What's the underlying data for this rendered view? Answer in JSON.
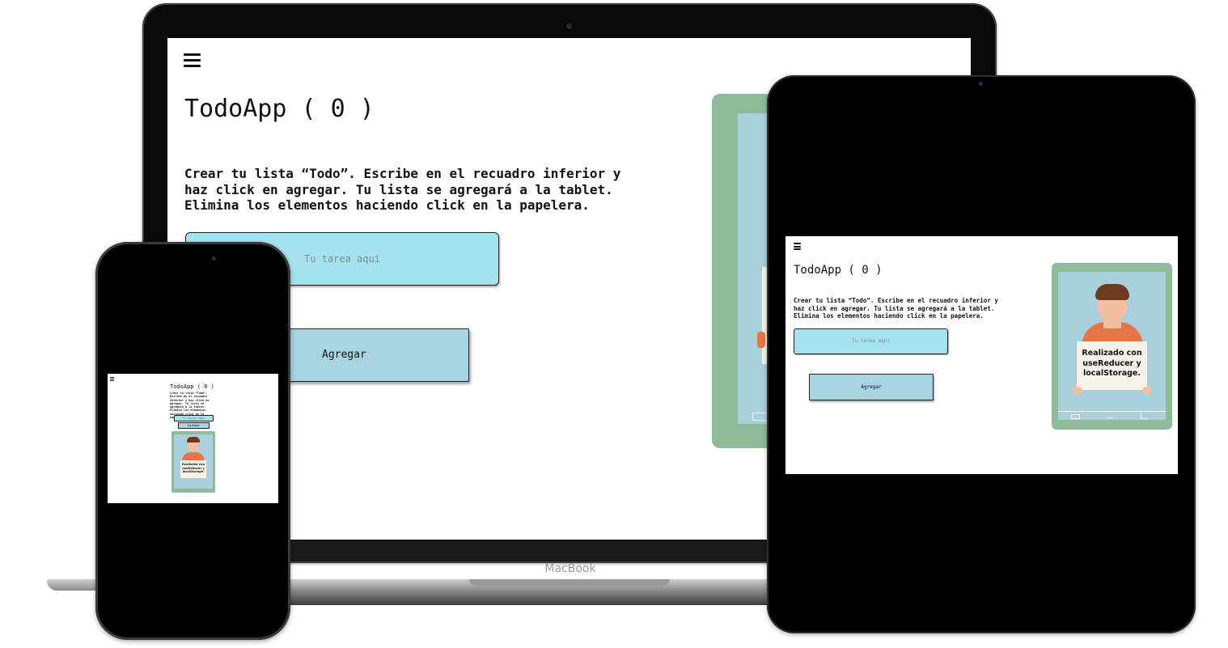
{
  "app": {
    "title": "TodoApp ( 0 )",
    "description": "Crear tu lista “Todo”. Escribe en el recuadro inferior y haz click en agregar. Tu lista se agregará a la tablet. Elimina los elementos haciendo click en la papelera.",
    "input_placeholder": "Tu tarea aqui",
    "add_button": "Agregar",
    "menu_icon": "hamburger-menu-icon"
  },
  "laptop": {
    "brand": "MacBook"
  },
  "illustration": {
    "sign_lines": [
      "Realizado con",
      "useReducer y",
      "localStorage."
    ],
    "colors": {
      "frame": "#8fbb9b",
      "screen": "#a9cfdd",
      "sweater": "#e57546",
      "hair": "#6b3a1f",
      "skin": "#f2c0a0"
    }
  },
  "colors": {
    "input_bg": "#a6e2ee",
    "button_bg": "#a8d3e1",
    "text": "#111111",
    "device_black": "#000000"
  }
}
